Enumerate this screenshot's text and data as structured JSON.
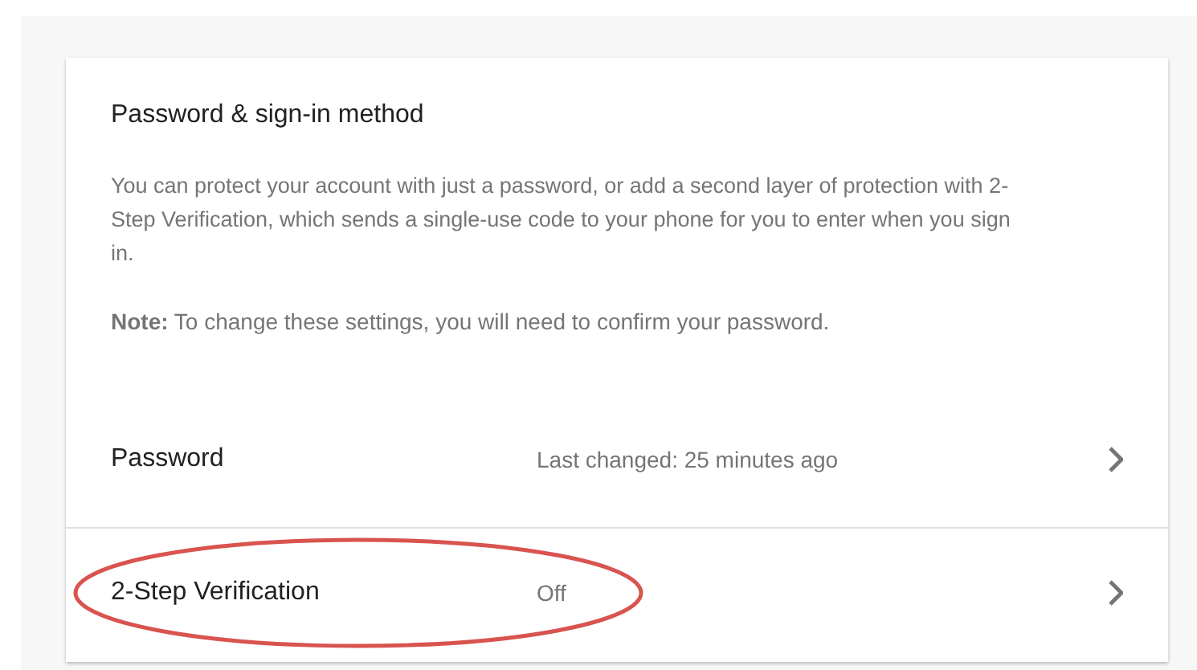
{
  "card": {
    "title": "Password & sign-in method",
    "description": "You can protect your account with just a password, or add a second layer of protection with 2-Step Verification, which sends a single-use code to your phone for you to enter when you sign in.",
    "note": "**Note:** To change these settings, you will need to confirm your password.",
    "rows": [
      {
        "label": "Password",
        "value": "Last changed: 25 minutes ago",
        "circled": false
      },
      {
        "label": "2-Step Verification",
        "value": "Off",
        "circled": true
      }
    ]
  }
}
